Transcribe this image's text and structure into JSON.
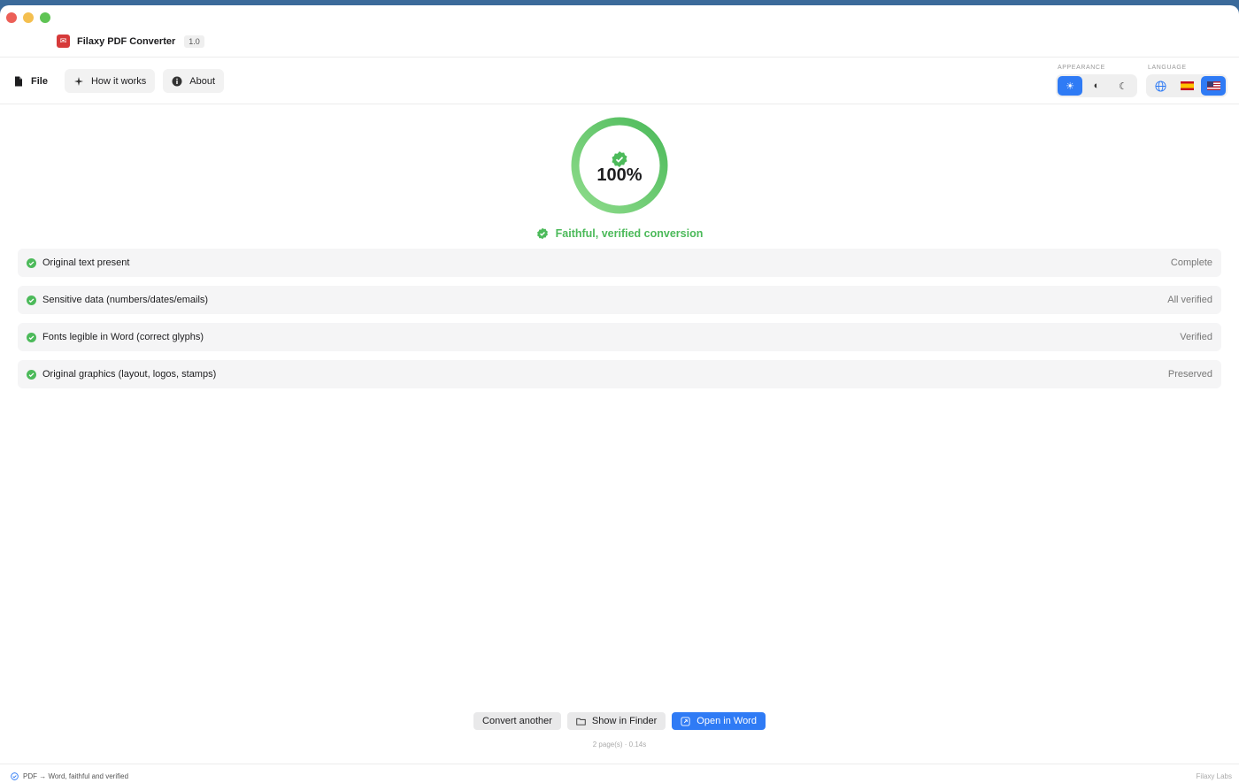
{
  "app": {
    "name": "Filaxy PDF Converter",
    "version": "1.0"
  },
  "toolbar": {
    "file": "File",
    "how_it_works": "How it works",
    "about": "About"
  },
  "appearance": {
    "label": "APPEARANCE",
    "options": [
      "light",
      "auto",
      "dark"
    ],
    "selected": "light"
  },
  "language": {
    "label": "LANGUAGE",
    "options": [
      "globe",
      "es",
      "us"
    ],
    "selected": "us"
  },
  "result": {
    "percent_text": "100%",
    "progress": 1.0,
    "verdict": "Faithful, verified conversion"
  },
  "checks": [
    {
      "label": "Original text present",
      "status": "Complete"
    },
    {
      "label": "Sensitive data (numbers/dates/emails)",
      "status": "All verified"
    },
    {
      "label": "Fonts legible in Word (correct glyphs)",
      "status": "Verified"
    },
    {
      "label": "Original graphics (layout, logos, stamps)",
      "status": "Preserved"
    }
  ],
  "actions": {
    "convert_another": "Convert another",
    "show_in_finder": "Show in Finder",
    "open_in_word": "Open in Word"
  },
  "meta": "2 page(s) · 0.14s",
  "statusbar": {
    "left": "PDF → Word, faithful and verified",
    "right": "Filaxy Labs"
  },
  "colors": {
    "accent": "#2f7bf5",
    "success": "#4cba5a"
  }
}
